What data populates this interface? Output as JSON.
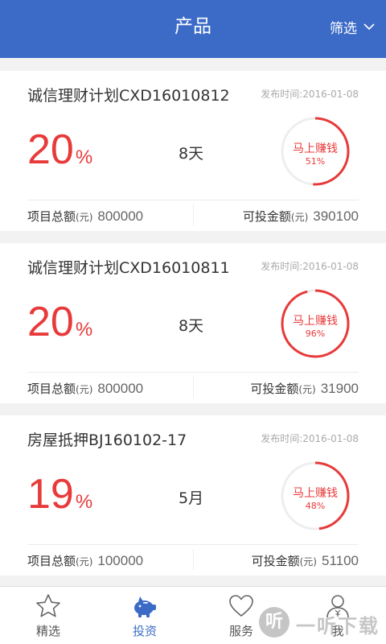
{
  "header": {
    "title": "产品",
    "filter_label": "筛选"
  },
  "products": [
    {
      "name": "诚信理财计划CXD16010812",
      "date": "发布时间:2016-01-08",
      "rate": "20",
      "rate_unit": "%",
      "term": "8天",
      "cta": "马上赚钱",
      "progress": 0.51,
      "progress_text": "51%",
      "total_label": "项目总额",
      "total_unit": "(元)",
      "total_value": "800000",
      "avail_label": "可投金额",
      "avail_unit": "(元)",
      "avail_value": "390100"
    },
    {
      "name": "诚信理财计划CXD16010811",
      "date": "发布时间:2016-01-08",
      "rate": "20",
      "rate_unit": "%",
      "term": "8天",
      "cta": "马上赚钱",
      "progress": 0.96,
      "progress_text": "96%",
      "total_label": "项目总额",
      "total_unit": "(元)",
      "total_value": "800000",
      "avail_label": "可投金额",
      "avail_unit": "(元)",
      "avail_value": "31900"
    },
    {
      "name": "房屋抵押BJ160102-17",
      "date": "发布时间:2016-01-08",
      "rate": "19",
      "rate_unit": "%",
      "term": "5月",
      "cta": "马上赚钱",
      "progress": 0.48,
      "progress_text": "48%",
      "total_label": "项目总额",
      "total_unit": "(元)",
      "total_value": "100000",
      "avail_label": "可投金额",
      "avail_unit": "(元)",
      "avail_value": "51100"
    }
  ],
  "tabs": [
    {
      "label": "精选",
      "icon": "star-icon"
    },
    {
      "label": "投资",
      "icon": "piggy-bank-icon",
      "active": true
    },
    {
      "label": "服务",
      "icon": "heart-icon"
    },
    {
      "label": "我",
      "icon": "user-icon"
    }
  ],
  "watermark": {
    "badge": "听",
    "text": "一听下载"
  },
  "colors": {
    "header": "#3b6bc7",
    "accent": "#e83a3a",
    "ring_track": "#eeeeee",
    "background": "#f2f2f2"
  }
}
